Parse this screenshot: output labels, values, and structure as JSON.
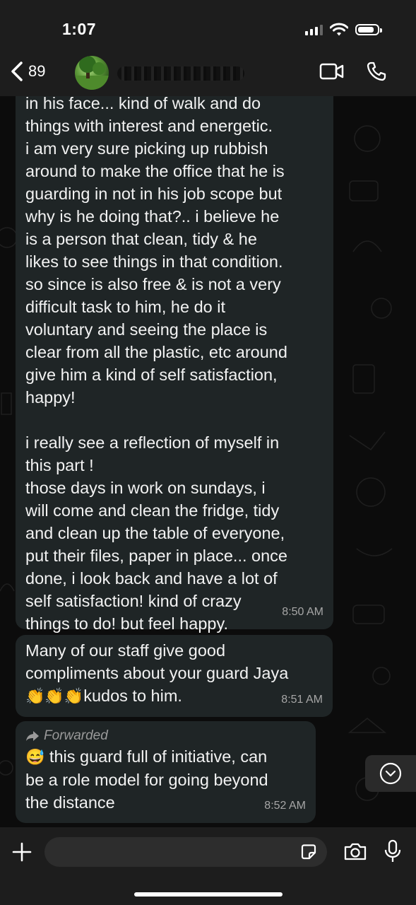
{
  "status_bar": {
    "time": "1:07",
    "signal_icon": "signal-icon",
    "wifi_icon": "wifi-icon",
    "battery_icon": "battery-icon",
    "battery_level": 0.85
  },
  "header": {
    "back_count": "89",
    "back_icon": "chevron-left-icon",
    "video_icon": "video-call-icon",
    "phone_icon": "phone-icon"
  },
  "messages": [
    {
      "text": "in his face... kind of walk and do\nthings with interest and energetic.\ni am very sure picking up rubbish\naround to make the office that he is\nguarding in not in his job scope but\nwhy is he doing that?.. i believe he\nis a person that clean, tidy & he\nlikes to see things in that condition.\nso since is also free & is not a very\ndifficult task to him, he do it\nvoluntary and seeing the place is\nclear from all the plastic, etc around\ngive him a kind of self satisfaction,\nhappy!\n\ni really see a reflection of myself in\nthis part !\nthose days in work on sundays, i\nwill come and clean the fridge, tidy\nand clean up the table of everyone,\nput their files, paper in place... once\ndone, i look back and have a lot of\nself satisfaction! kind of crazy\nthings to do! but feel happy.",
      "time": "8:50 AM"
    },
    {
      "text": "Many of our staff give good\ncompliments about your guard Jaya",
      "emojis": "👏👏👏",
      "text_after": "kudos to him.",
      "time": "8:51 AM"
    },
    {
      "forwarded_label": "Forwarded",
      "emoji": "😅",
      "text": " this guard full of initiative, can\nbe a role model for going beyond\nthe distance",
      "time": "8:52 AM"
    }
  ],
  "composer": {
    "plus_icon": "plus-icon",
    "sticker_icon": "sticker-icon",
    "camera_icon": "camera-icon",
    "mic_icon": "microphone-icon"
  },
  "scroll_icon": "chevron-down-circle-icon"
}
